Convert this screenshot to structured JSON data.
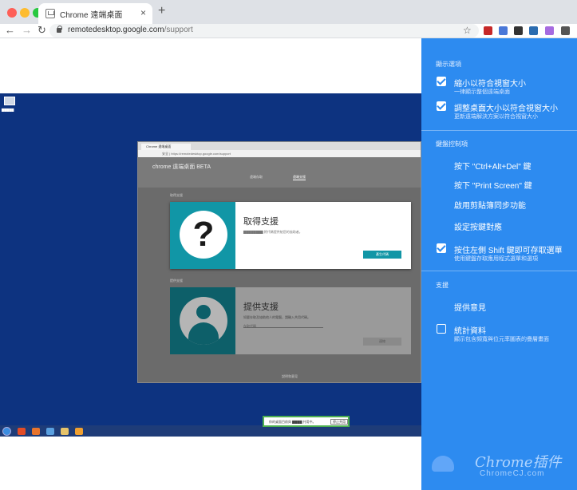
{
  "browser": {
    "tab_title": "Chrome 遠端桌面",
    "tab_close": "×",
    "new_tab": "+",
    "url_host": "remotedesktop.google.com",
    "url_path": "/support",
    "back": "←",
    "forward": "→",
    "reload": "↻",
    "star": "☆"
  },
  "remote": {
    "tab_title": "Chrome 遠端桌面",
    "url": "安全 | https://remotedesktop.google.com/support",
    "logo": "chrome 遠端桌面 BETA",
    "nav_access": "遠端存取",
    "nav_support": "遠端支援",
    "section_get": "取得支援",
    "section_give": "提供支援",
    "get_title": "取得支援",
    "get_desc": "▇▇▇▇▇▇▇▇ 將代碼提供給您的協助者。",
    "get_button": "產生代碼",
    "give_title": "提供支援",
    "give_desc": "如要存取及協助他人的電腦，請輸入共用代碼。",
    "give_placeholder": "存取代碼",
    "give_button": "連線",
    "footer": "說明和意見",
    "share_text": "你的桌面目前與 ▇▇▇▇ 共用中。",
    "share_button": "停止共用"
  },
  "panel": {
    "display_heading": "顯示選項",
    "shrink_label": "縮小以符合視窗大小",
    "shrink_sub": "一律顯示整個遠端桌面",
    "resize_label": "調整桌面大小以符合視窗大小",
    "resize_sub": "更新遠端解決方案以符合視窗大小",
    "keyboard_heading": "鍵盤控制項",
    "cad_label": "按下 \"Ctrl+Alt+Del\" 鍵",
    "prtsc_label": "按下 \"Print Screen\" 鍵",
    "clipboard_label": "啟用剪貼簿同步功能",
    "mapping_label": "設定按鍵對應",
    "shift_label": "按住左側 Shift 鍵即可存取選單",
    "shift_sub": "使用鍵盤存取應用程式選單和選項",
    "support_heading": "支援",
    "feedback_label": "提供意見",
    "stats_label": "統計資料",
    "stats_sub": "顯示包含頻寬與位元率圖表的疊層畫面"
  },
  "watermark": {
    "title": "Chrome插件",
    "sub": "ChromeCJ.com"
  },
  "colors": {
    "panel": "#2d8bf0",
    "desktop": "#0d3380",
    "teal": "#1196a6"
  }
}
